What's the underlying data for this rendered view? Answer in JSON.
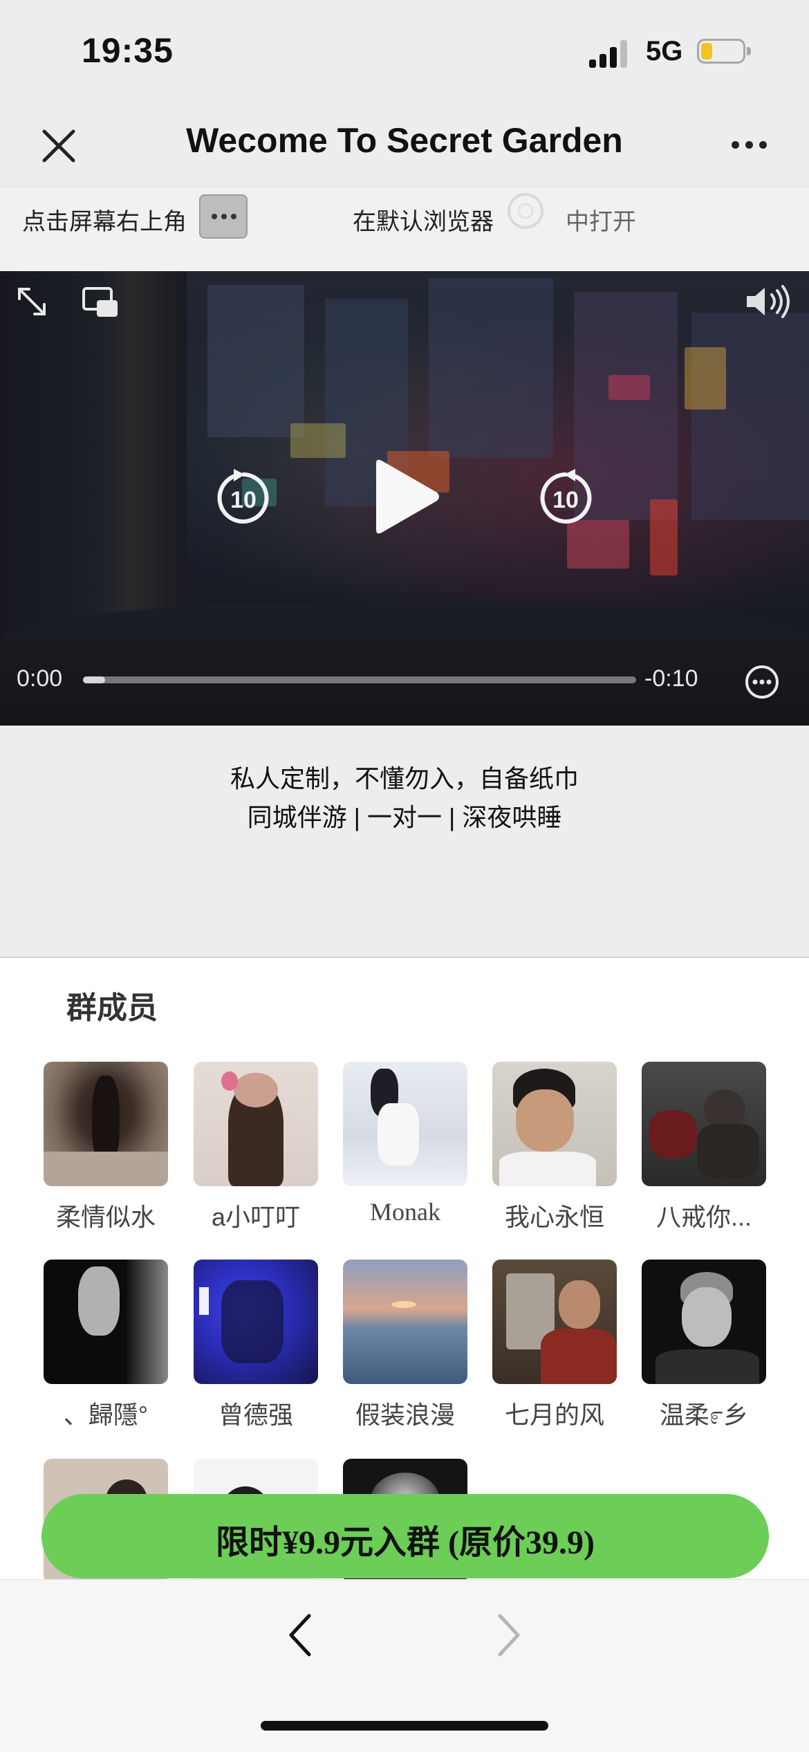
{
  "status_bar": {
    "time": "19:35",
    "network": "5G",
    "battery_level": 0.28,
    "colors": {
      "battery_fill": "#f5c31b"
    }
  },
  "nav": {
    "title": "Wecome To Secret Garden",
    "close_icon": "close-icon",
    "more_icon": "more-dots-icon"
  },
  "hint": {
    "part1": "点击屏幕右上角",
    "part2": "在默认浏览器",
    "part3": "中打开"
  },
  "video": {
    "elapsed": "0:00",
    "remaining": "-0:10",
    "progress": 0.04,
    "skip_seconds": "10",
    "icons": [
      "expand-icon",
      "picture-in-picture-icon",
      "volume-icon",
      "rewind-10-icon",
      "play-icon",
      "forward-10-icon",
      "options-icon"
    ]
  },
  "description": {
    "line1": "私人定制，不懂勿入，自备纸巾",
    "line2": "同城伴游 | 一对一 | 深夜哄睡"
  },
  "members": {
    "title": "群成员",
    "list": [
      {
        "name": "柔情似水"
      },
      {
        "name": "a小叮叮"
      },
      {
        "name": "Monak"
      },
      {
        "name": "我心永恒"
      },
      {
        "name": "八戒你..."
      },
      {
        "name": "、歸隱°"
      },
      {
        "name": "曾德强"
      },
      {
        "name": "假装浪漫"
      },
      {
        "name": "七月的风"
      },
      {
        "name": "温柔೯乡"
      }
    ]
  },
  "join_button": {
    "label": "限时¥9.9元入群 (原价39.9)",
    "color": "#6ccd57"
  },
  "toolbar": {
    "back_icon": "chevron-left-icon",
    "forward_icon": "chevron-right-icon"
  }
}
